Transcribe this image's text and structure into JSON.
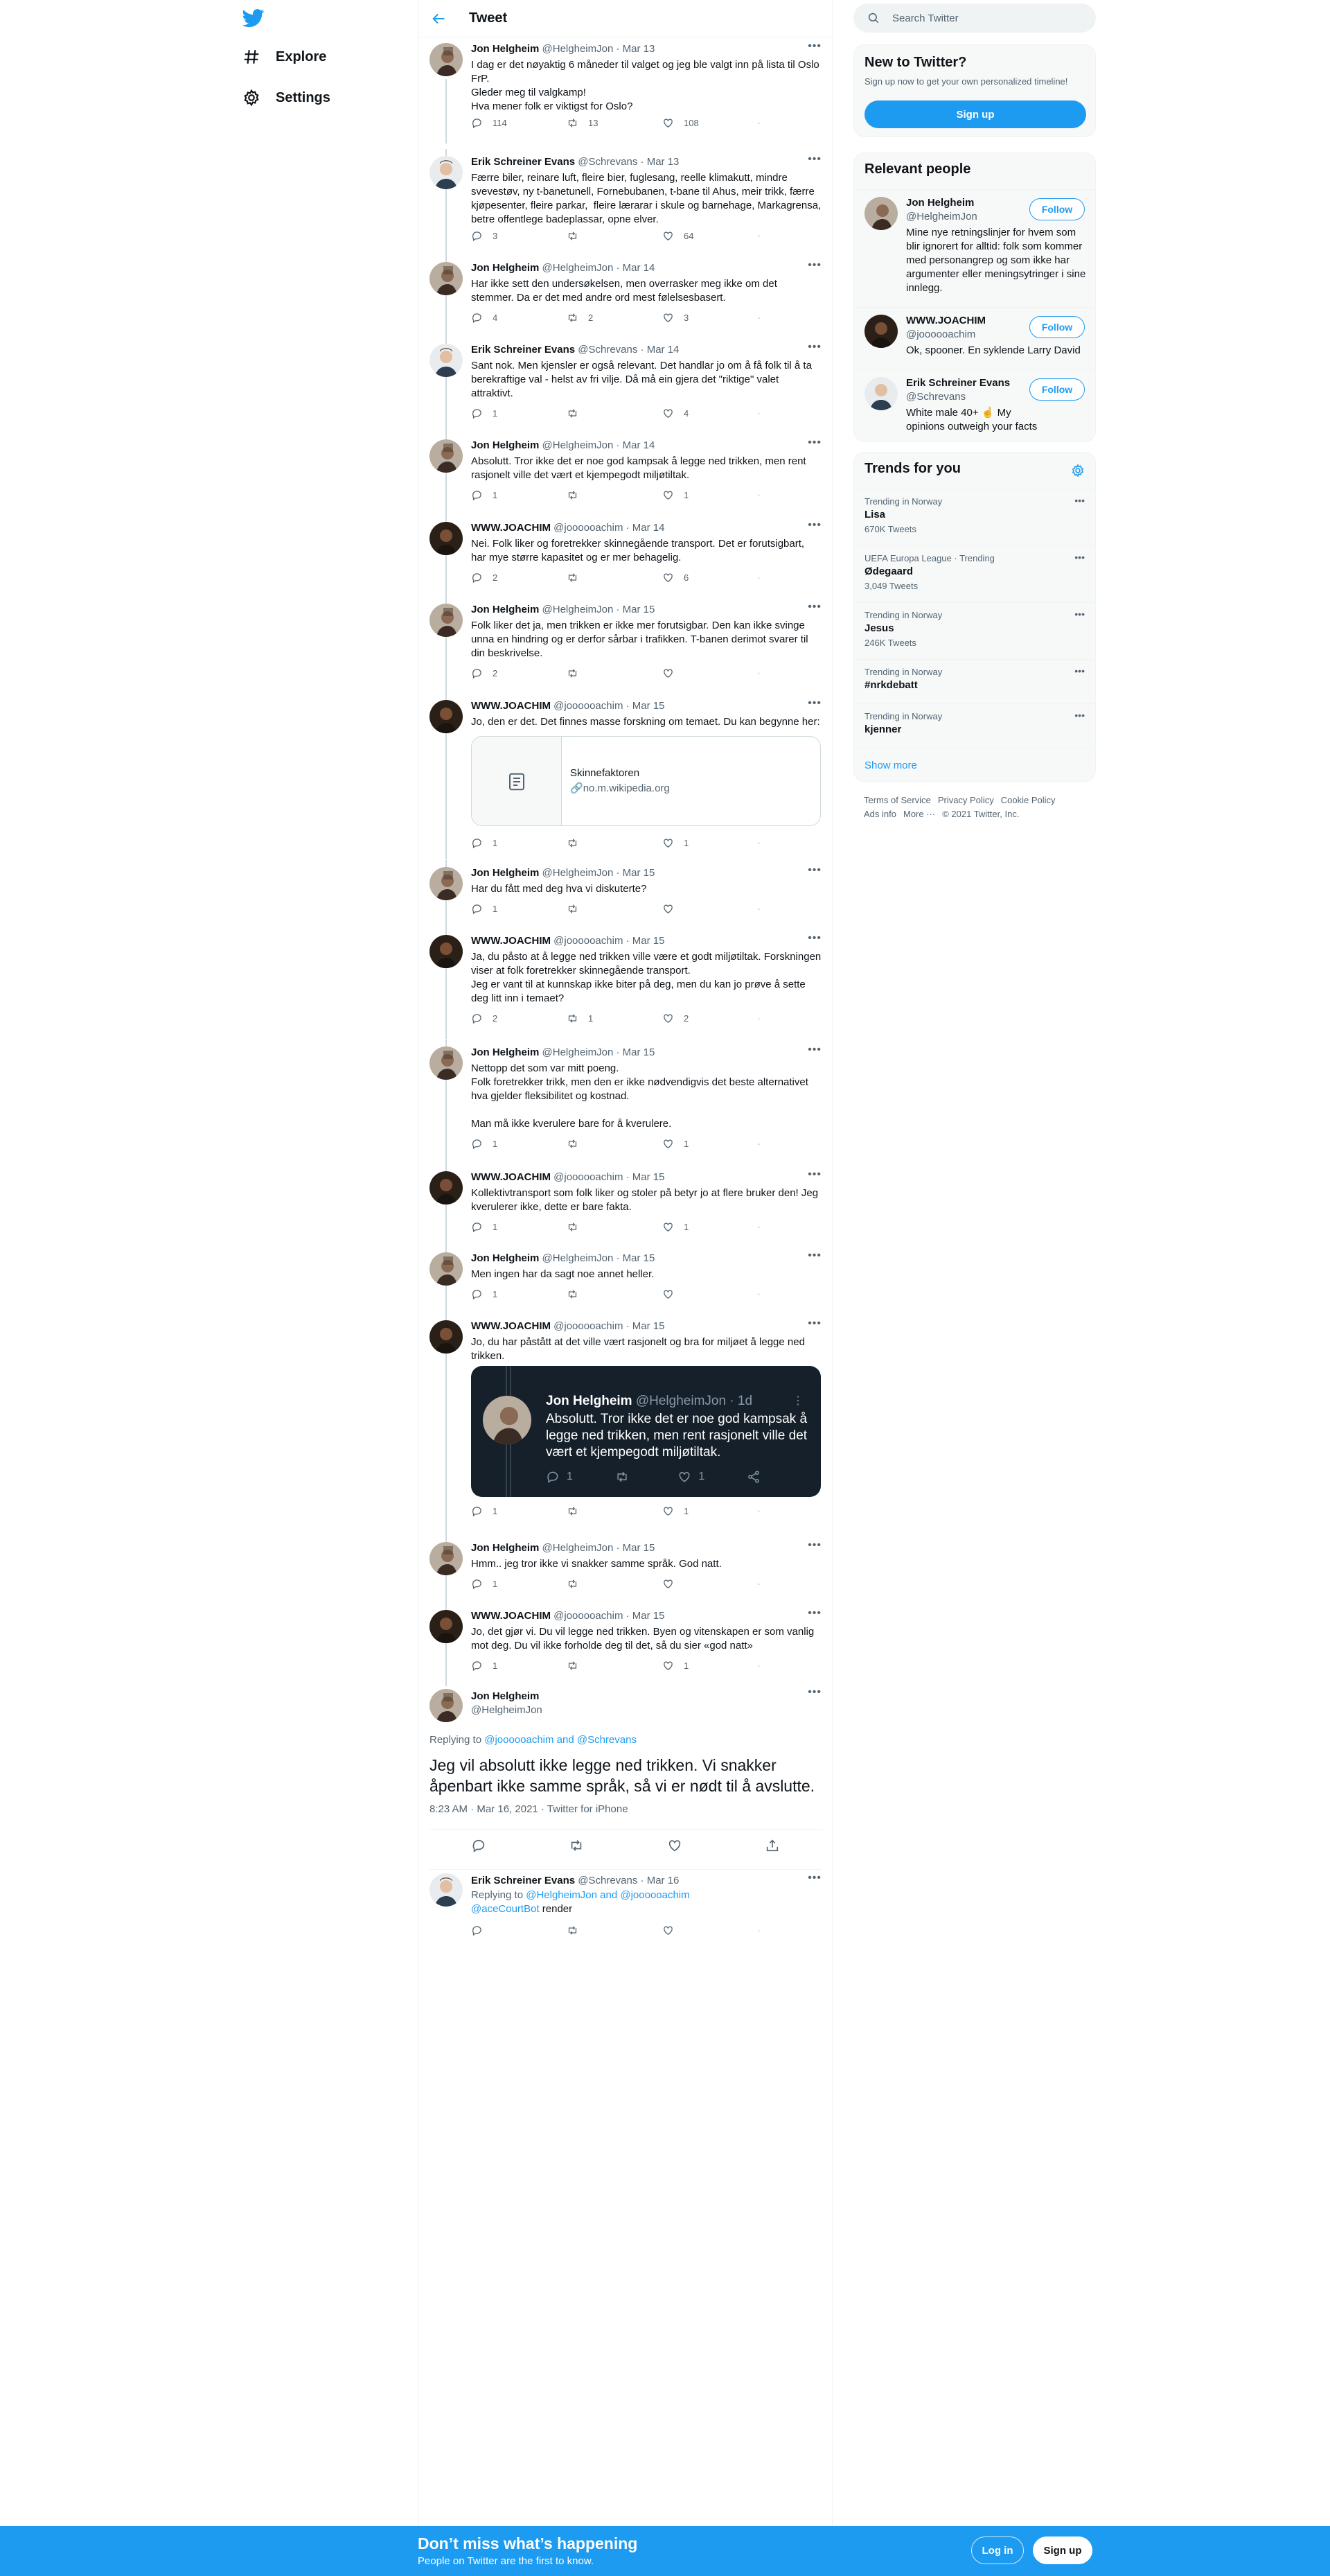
{
  "nav": {
    "explore": "Explore",
    "settings": "Settings"
  },
  "header": {
    "title": "Tweet"
  },
  "thread": [
    {
      "name": "Jon Helgheim",
      "handle": "@HelgheimJon",
      "date": "Mar 13",
      "text": "I dag er det nøyaktig 6 måneder til valget og jeg ble valgt inn på lista til Oslo FrP.\nGleder meg til valgkamp!\nHva mener folk er viktigst for Oslo?",
      "reply": "114",
      "retweet": "13",
      "like": "108",
      "avatar": "jon"
    },
    {
      "name": "Erik Schreiner Evans",
      "handle": "@Schrevans",
      "date": "Mar 13",
      "text": "Færre biler, reinare luft, fleire bier, fuglesang, reelle klimakutt, mindre svevestøv, ny t-banetunell, Fornebubanen, t-bane til Ahus, meir trikk, færre kjøpesenter, fleire parkar,  fleire lærarar i skule og barnehage, Markagrensa, betre offentlege badeplassar, opne elver.",
      "reply": "3",
      "retweet": "",
      "like": "64",
      "avatar": "erik"
    },
    {
      "name": "Jon Helgheim",
      "handle": "@HelgheimJon",
      "date": "Mar 14",
      "text": "Har ikke sett den undersøkelsen, men overrasker meg ikke om det stemmer. Da er det med andre ord mest følelsesbasert.",
      "reply": "4",
      "retweet": "2",
      "like": "3",
      "avatar": "jon"
    },
    {
      "name": "Erik Schreiner Evans",
      "handle": "@Schrevans",
      "date": "Mar 14",
      "text": "Sant nok. Men kjensler er også relevant. Det handlar jo om å få folk til å ta berekraftige val - helst av fri vilje. Då må ein gjera det \"riktige\" valet attraktivt.",
      "reply": "1",
      "retweet": "",
      "like": "4",
      "avatar": "erik"
    },
    {
      "name": "Jon Helgheim",
      "handle": "@HelgheimJon",
      "date": "Mar 14",
      "text": "Absolutt. Tror ikke det er noe god kampsak å legge ned trikken, men rent rasjonelt ville det vært et kjempegodt miljøtiltak.",
      "reply": "1",
      "retweet": "",
      "like": "1",
      "avatar": "jon"
    },
    {
      "name": "WWW.JOACHIM",
      "handle": "@joooooachim",
      "date": "Mar 14",
      "text": "Nei. Folk liker og foretrekker skinnegående transport. Det er forutsigbart, har mye større kapasitet og er mer behagelig.",
      "reply": "2",
      "retweet": "",
      "like": "6",
      "avatar": "joachim"
    },
    {
      "name": "Jon Helgheim",
      "handle": "@HelgheimJon",
      "date": "Mar 15",
      "text": "Folk liker det ja, men trikken er ikke mer forutsigbar. Den kan ikke svinge unna en hindring og er derfor sårbar i trafikken. T-banen derimot svarer til din beskrivelse.",
      "reply": "2",
      "retweet": "",
      "like": "",
      "avatar": "jon"
    },
    {
      "name": "WWW.JOACHIM",
      "handle": "@joooooachim",
      "date": "Mar 15",
      "text": "Jo, den er det. Det finnes masse forskning om temaet. Du kan begynne her:",
      "reply": "1",
      "retweet": "",
      "like": "1",
      "avatar": "joachim"
    },
    {
      "name": "Jon Helgheim",
      "handle": "@HelgheimJon",
      "date": "Mar 15",
      "text": "Har du fått med deg hva vi diskuterte?",
      "reply": "1",
      "retweet": "",
      "like": "",
      "avatar": "jon"
    },
    {
      "name": "WWW.JOACHIM",
      "handle": "@joooooachim",
      "date": "Mar 15",
      "text": "Ja, du påsto at å legge ned trikken ville være et godt miljøtiltak. Forskningen viser at folk foretrekker skinnegående transport.\nJeg er vant til at kunnskap ikke biter på deg, men du kan jo prøve å sette deg litt inn i temaet?",
      "reply": "2",
      "retweet": "1",
      "like": "2",
      "avatar": "joachim"
    },
    {
      "name": "Jon Helgheim",
      "handle": "@HelgheimJon",
      "date": "Mar 15",
      "text": "Nettopp det som var mitt poeng.\nFolk foretrekker trikk, men den er ikke nødvendigvis det beste alternativet hva gjelder fleksibilitet og kostnad.\n\nMan må ikke kverulere bare for å kverulere.",
      "reply": "1",
      "retweet": "",
      "like": "1",
      "avatar": "jon"
    },
    {
      "name": "WWW.JOACHIM",
      "handle": "@joooooachim",
      "date": "Mar 15",
      "text": "Kollektivtransport som folk liker og stoler på betyr jo at flere bruker den! Jeg kverulerer ikke, dette er bare fakta.",
      "reply": "1",
      "retweet": "",
      "like": "1",
      "avatar": "joachim"
    },
    {
      "name": "Jon Helgheim",
      "handle": "@HelgheimJon",
      "date": "Mar 15",
      "text": "Men ingen har da sagt noe annet heller.",
      "reply": "1",
      "retweet": "",
      "like": "",
      "avatar": "jon"
    },
    {
      "name": "WWW.JOACHIM",
      "handle": "@joooooachim",
      "date": "Mar 15",
      "text": "Jo, du har påstått at det ville vært rasjonelt og bra for miljøet å legge ned trikken.",
      "reply": "1",
      "retweet": "",
      "like": "1",
      "avatar": "joachim"
    },
    {
      "name": "Jon Helgheim",
      "handle": "@HelgheimJon",
      "date": "Mar 15",
      "text": "Hmm.. jeg tror ikke vi snakker samme språk. God natt.",
      "reply": "1",
      "retweet": "",
      "like": "",
      "avatar": "jon"
    },
    {
      "name": "WWW.JOACHIM",
      "handle": "@joooooachim",
      "date": "Mar 15",
      "text": "Jo, det gjør vi. Du vil legge ned trikken. Byen og vitenskapen er som vanlig mot deg. Du vil ikke forholde deg til det, så du sier «god natt»",
      "reply": "1",
      "retweet": "",
      "like": "1",
      "avatar": "joachim"
    }
  ],
  "link_card": {
    "title": "Skinnefaktoren",
    "domain": "no.m.wikipedia.org"
  },
  "screenshot": {
    "name": "Jon Helgheim",
    "handle": "@HelgheimJon · 1d",
    "text": "Absolutt. Tror ikke det er noe god kampsak å legge ned trikken, men rent rasjonelt ville det vært et kjempegodt miljøtiltak.",
    "reply": "1",
    "like": "1"
  },
  "focal": {
    "name": "Jon Helgheim",
    "handle": "@HelgheimJon",
    "replying_prefix": "Replying to ",
    "replying_to": "@joooooachim and @Schrevans",
    "text": "Jeg vil absolutt ikke legge ned trikken. Vi snakker åpenbart ikke samme språk, så vi er nødt til å avslutte.",
    "meta": "8:23 AM · Mar 16, 2021 · Twitter for iPhone"
  },
  "last_reply": {
    "name": "Erik Schreiner Evans",
    "handle": "@Schrevans",
    "date": "Mar 16",
    "replying_prefix": "Replying to ",
    "replying_to": "@HelgheimJon and @joooooachim",
    "mention": "@aceCourtBot",
    "text": " render"
  },
  "right": {
    "search_placeholder": "Search Twitter",
    "new_title": "New to Twitter?",
    "new_sub": "Sign up now to get your own personalized timeline!",
    "signup": "Sign up",
    "relevant_title": "Relevant people",
    "follow": "Follow",
    "people": [
      {
        "name": "Jon Helgheim",
        "handle": "@HelgheimJon",
        "bio": "Mine nye retningslinjer for hvem som blir ignorert for alltid: folk som kommer med personangrep og som ikke har argumenter eller meningsytringer i sine innlegg."
      },
      {
        "name": "WWW.JOACHIM",
        "handle": "@joooooachim",
        "bio": "Ok, spooner. En syklende Larry David"
      },
      {
        "name": "Erik Schreiner Evans",
        "handle": "@Schrevans",
        "bio": "White male 40+ ☝️ My opinions outweigh your facts"
      }
    ],
    "trends_title": "Trends for you",
    "trends": [
      {
        "cat": "Trending in Norway",
        "name": "Lisa",
        "count": "670K Tweets"
      },
      {
        "cat": "UEFA Europa League · Trending",
        "name": "Ødegaard",
        "count": "3,049 Tweets"
      },
      {
        "cat": "Trending in Norway",
        "name": "Jesus",
        "count": "246K Tweets"
      },
      {
        "cat": "Trending in Norway",
        "name": "#nrkdebatt",
        "count": ""
      },
      {
        "cat": "Trending in Norway",
        "name": "kjenner",
        "count": ""
      }
    ],
    "show_more": "Show more",
    "footer": [
      "Terms of Service",
      "Privacy Policy",
      "Cookie Policy",
      "Ads info",
      "More ···",
      "© 2021 Twitter, Inc."
    ]
  },
  "bottom": {
    "title": "Don’t miss what’s happening",
    "sub": "People on Twitter are the first to know.",
    "login": "Log in",
    "signup": "Sign up"
  },
  "colors": {
    "accent": "#1d9bf0",
    "text": "#0f1419",
    "muted": "#536471"
  }
}
